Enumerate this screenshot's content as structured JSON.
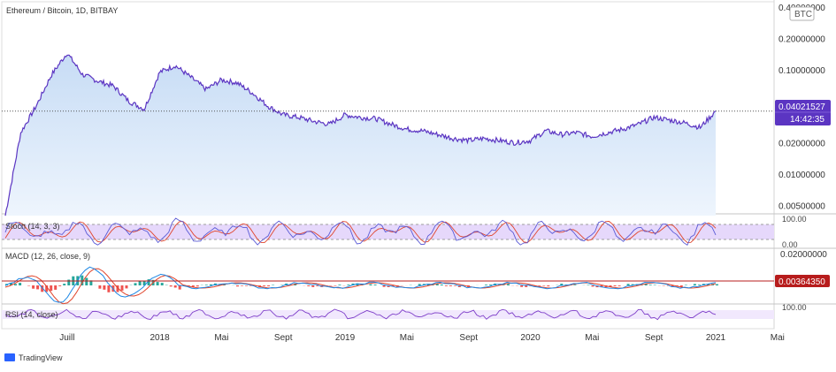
{
  "title": "Ethereum / Bitcoin, 1D, BITBAY",
  "currency_badge": "BTC",
  "price_tag": {
    "value": "0.04021527",
    "countdown": "14:42:35",
    "color": "#5b35c2"
  },
  "price_axis_labels": [
    "0.40000000",
    "0.20000000",
    "0.10000000",
    "0.04021527",
    "0.02000000",
    "0.01000000",
    "0.00500000"
  ],
  "stoch": {
    "label": "Stoch (14, 3, 3)",
    "levels": [
      "100.00",
      "0.00"
    ]
  },
  "macd": {
    "label": "MACD (12, 26, close, 9)",
    "axis_top": "0.02000000",
    "tag": "0.00364350",
    "tag_color": "#b71c1c"
  },
  "rsi": {
    "label": "RSI (14, close)",
    "level": "100.00"
  },
  "time_axis": [
    "Juill",
    "2018",
    "Mai",
    "Sept",
    "2019",
    "Mai",
    "Sept",
    "2020",
    "Mai",
    "Sept",
    "2021",
    "Mai"
  ],
  "branding": {
    "text": "TradingView"
  },
  "colors": {
    "price_line": "#5b35c2",
    "area_top": "#c7dcf5",
    "area_bottom": "#eef5fd",
    "stoch_band": "#e6d8fb",
    "macd_signal": "#e0452c",
    "macd_line": "#1e88e5"
  },
  "chart_data": {
    "type": "line",
    "title": "Ethereum / Bitcoin, 1D, BITBAY",
    "y_scale": "log",
    "ylim": [
      0.004,
      0.4
    ],
    "x": [
      "2017-03",
      "2017-04",
      "2017-05",
      "2017-06",
      "2017-07",
      "2017-08",
      "2017-09",
      "2017-10",
      "2017-11",
      "2017-12",
      "2018-01",
      "2018-02",
      "2018-03",
      "2018-04",
      "2018-05",
      "2018-06",
      "2018-07",
      "2018-08",
      "2018-09",
      "2018-10",
      "2018-11",
      "2018-12",
      "2019-01",
      "2019-02",
      "2019-03",
      "2019-04",
      "2019-05",
      "2019-06",
      "2019-07",
      "2019-08",
      "2019-09",
      "2019-10",
      "2019-11",
      "2019-12",
      "2020-01",
      "2020-02",
      "2020-03",
      "2020-04",
      "2020-05",
      "2020-06",
      "2020-07",
      "2020-08",
      "2020-09",
      "2020-10",
      "2020-11",
      "2020-12",
      "2021-01"
    ],
    "series": [
      {
        "values": [
          0.004,
          0.025,
          0.045,
          0.09,
          0.145,
          0.09,
          0.078,
          0.07,
          0.05,
          0.042,
          0.095,
          0.11,
          0.085,
          0.065,
          0.08,
          0.075,
          0.06,
          0.045,
          0.037,
          0.035,
          0.032,
          0.03,
          0.037,
          0.035,
          0.034,
          0.03,
          0.027,
          0.026,
          0.024,
          0.022,
          0.021,
          0.022,
          0.021,
          0.02,
          0.021,
          0.026,
          0.024,
          0.025,
          0.023,
          0.025,
          0.027,
          0.03,
          0.035,
          0.033,
          0.031,
          0.028,
          0.04021527
        ]
      }
    ],
    "current_value": 0.04021527,
    "macd_current": 0.0036435,
    "stoch_range": [
      0,
      100
    ]
  }
}
